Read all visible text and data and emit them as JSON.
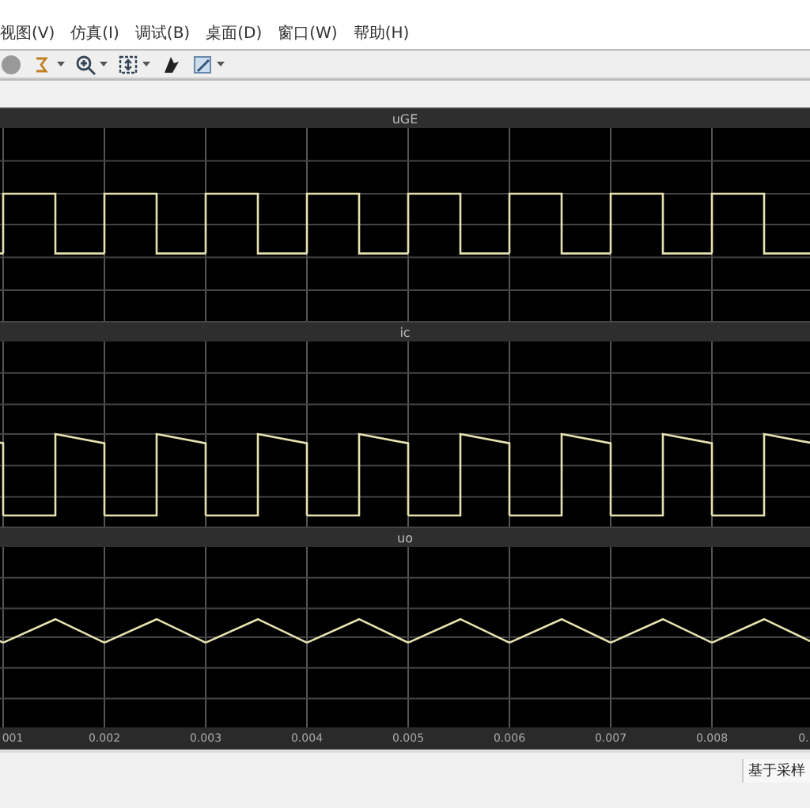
{
  "menu": [
    "视图(V)",
    "仿真(I)",
    "调试(B)",
    "桌面(D)",
    "窗口(W)",
    "帮助(H)"
  ],
  "toolbar": [
    {
      "kind": "stop",
      "dropdown": false
    },
    {
      "kind": "style",
      "dropdown": true
    },
    {
      "kind": "zoom",
      "dropdown": true
    },
    {
      "kind": "fit",
      "dropdown": true
    },
    {
      "kind": "cursor",
      "dropdown": false
    },
    {
      "kind": "edit",
      "dropdown": true
    }
  ],
  "panels": [
    {
      "title": "uGE",
      "kind": "square"
    },
    {
      "title": "ic",
      "kind": "ramp"
    },
    {
      "title": "uo",
      "kind": "triangle"
    }
  ],
  "x_ticks": [
    "001",
    "0.002",
    "0.003",
    "0.004",
    "0.005",
    "0.006",
    "0.007",
    "0.008",
    "0."
  ],
  "status_bar": {
    "text": "基于采样"
  }
}
